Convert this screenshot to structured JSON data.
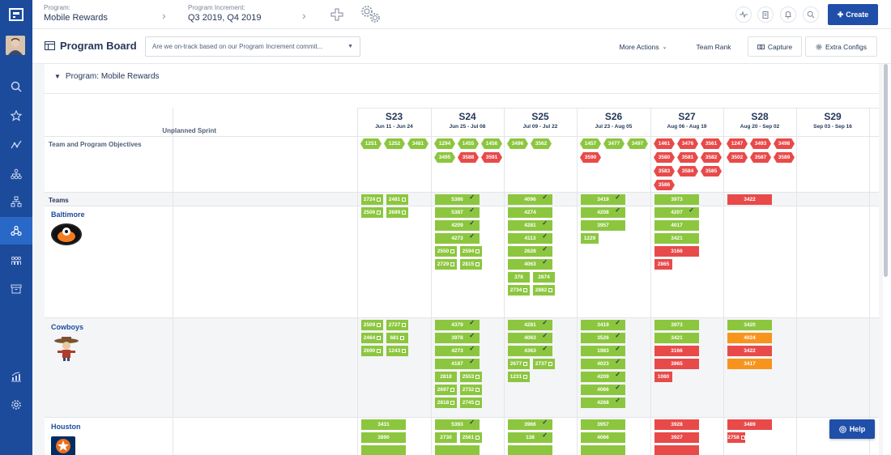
{
  "topbar": {
    "program_label": "Program:",
    "program_value": "Mobile Rewards",
    "pi_label": "Program Increment:",
    "pi_value": "Q3 2019, Q4 2019",
    "create_label": "Create"
  },
  "toolbar": {
    "title": "Program Board",
    "filter_text": "Are we on-track based on our Program Increment commit...",
    "more_actions": "More Actions",
    "team_rank": "Team Rank",
    "capture": "Capture",
    "extra_configs": "Extra Configs"
  },
  "board": {
    "program_title": "Program: Mobile Rewards",
    "unplanned_label": "Unplanned Sprint",
    "objectives_label": "Team and Program Objectives",
    "teams_label": "Teams"
  },
  "sprints": [
    {
      "name": "S23",
      "dates": "Jun 11 - Jun 24"
    },
    {
      "name": "S24",
      "dates": "Jun 25 - Jul 08"
    },
    {
      "name": "S25",
      "dates": "Jul 09 - Jul 22"
    },
    {
      "name": "S26",
      "dates": "Jul 23 - Aug 05"
    },
    {
      "name": "S27",
      "dates": "Aug 06 - Aug 19"
    },
    {
      "name": "S28",
      "dates": "Aug 20 - Sep 02"
    },
    {
      "name": "S29",
      "dates": "Sep 03 - Sep 16"
    }
  ],
  "objectives": [
    [
      {
        "id": "1251",
        "c": "g"
      },
      {
        "id": "1252",
        "c": "g"
      },
      {
        "id": "3481",
        "c": "g"
      }
    ],
    [
      {
        "id": "1294",
        "c": "g"
      },
      {
        "id": "1455",
        "c": "g"
      },
      {
        "id": "1456",
        "c": "g"
      },
      {
        "id": "3495",
        "c": "g"
      },
      {
        "id": "3588",
        "c": "r"
      },
      {
        "id": "3591",
        "c": "r"
      }
    ],
    [
      {
        "id": "3496",
        "c": "g"
      },
      {
        "id": "3562",
        "c": "g"
      }
    ],
    [
      {
        "id": "1457",
        "c": "g"
      },
      {
        "id": "3477",
        "c": "g"
      },
      {
        "id": "3497",
        "c": "g"
      },
      {
        "id": "3590",
        "c": "r"
      }
    ],
    [
      {
        "id": "1461",
        "c": "r"
      },
      {
        "id": "3476",
        "c": "r"
      },
      {
        "id": "3561",
        "c": "r"
      },
      {
        "id": "3580",
        "c": "r"
      },
      {
        "id": "3581",
        "c": "r"
      },
      {
        "id": "3582",
        "c": "r"
      },
      {
        "id": "3583",
        "c": "r"
      },
      {
        "id": "3584",
        "c": "r"
      },
      {
        "id": "3585",
        "c": "r"
      },
      {
        "id": "3586",
        "c": "r"
      }
    ],
    [
      {
        "id": "1247",
        "c": "r"
      },
      {
        "id": "3493",
        "c": "r"
      },
      {
        "id": "3498",
        "c": "r"
      },
      {
        "id": "3502",
        "c": "r"
      },
      {
        "id": "3587",
        "c": "r"
      },
      {
        "id": "3589",
        "c": "r"
      }
    ],
    []
  ],
  "teams": [
    {
      "name": "Baltimore",
      "logo": "orioles",
      "sprints": [
        [
          {
            "id": "2724",
            "c": "g",
            "m": "sq",
            "s": "half"
          },
          {
            "id": "2481",
            "c": "g",
            "m": "sq",
            "s": "half"
          },
          {
            "id": "2506",
            "c": "g",
            "m": "sq",
            "s": "half"
          },
          {
            "id": "2689",
            "c": "g",
            "m": "sq",
            "s": "half"
          }
        ],
        [
          {
            "id": "5386",
            "c": "g",
            "m": "tick"
          },
          {
            "id": "5387",
            "c": "g",
            "m": "tick"
          },
          {
            "id": "4209",
            "c": "g",
            "m": "tick"
          },
          {
            "id": "4273",
            "c": "g",
            "m": "tick"
          },
          {
            "id": "2550",
            "c": "g",
            "m": "sq",
            "s": "half"
          },
          {
            "id": "2594",
            "c": "g",
            "m": "sq",
            "s": "half"
          },
          {
            "id": "2729",
            "c": "g",
            "m": "sq",
            "s": "half"
          },
          {
            "id": "2815",
            "c": "g",
            "m": "sq",
            "s": "half"
          }
        ],
        [
          {
            "id": "4096",
            "c": "g",
            "m": "tick"
          },
          {
            "id": "4274",
            "c": "g"
          },
          {
            "id": "4281",
            "c": "g",
            "m": "tick"
          },
          {
            "id": "4113",
            "c": "g",
            "m": "tick"
          },
          {
            "id": "2628",
            "c": "g",
            "m": "tick"
          },
          {
            "id": "4063",
            "c": "g",
            "m": "tick"
          },
          {
            "id": "378",
            "c": "g",
            "s": "half"
          },
          {
            "id": "2874",
            "c": "g",
            "s": "half"
          },
          {
            "id": "2734",
            "c": "g",
            "m": "sq",
            "s": "half"
          },
          {
            "id": "2882",
            "c": "g",
            "m": "sq",
            "s": "half"
          }
        ],
        [
          {
            "id": "3419",
            "c": "g",
            "m": "tick"
          },
          {
            "id": "4208",
            "c": "g",
            "m": "tick"
          },
          {
            "id": "3957",
            "c": "g"
          },
          {
            "id": "1229",
            "c": "g",
            "s": "small"
          }
        ],
        [
          {
            "id": "3973",
            "c": "g"
          },
          {
            "id": "4207",
            "c": "g",
            "m": "tick"
          },
          {
            "id": "4017",
            "c": "g"
          },
          {
            "id": "3421",
            "c": "g"
          },
          {
            "id": "3166",
            "c": "r"
          },
          {
            "id": "2865",
            "c": "r",
            "s": "small"
          }
        ],
        [
          {
            "id": "3422",
            "c": "r"
          }
        ],
        []
      ]
    },
    {
      "name": "Cowboys",
      "logo": "cowboy",
      "sprints": [
        [
          {
            "id": "2509",
            "c": "g",
            "m": "sq",
            "s": "half"
          },
          {
            "id": "2727",
            "c": "g",
            "m": "sq",
            "s": "half"
          },
          {
            "id": "2464",
            "c": "g",
            "m": "sq",
            "s": "half"
          },
          {
            "id": "681",
            "c": "g",
            "m": "sq",
            "s": "half"
          },
          {
            "id": "2690",
            "c": "g",
            "m": "sq",
            "s": "half"
          },
          {
            "id": "1243",
            "c": "g",
            "m": "sq",
            "s": "half"
          }
        ],
        [
          {
            "id": "4379",
            "c": "g",
            "m": "tick"
          },
          {
            "id": "3978",
            "c": "g",
            "m": "tick"
          },
          {
            "id": "4273",
            "c": "g",
            "m": "tick"
          },
          {
            "id": "4187",
            "c": "g",
            "m": "tick"
          },
          {
            "id": "2818",
            "c": "g",
            "s": "half"
          },
          {
            "id": "2553",
            "c": "g",
            "m": "sq",
            "s": "half"
          },
          {
            "id": "2697",
            "c": "g",
            "m": "sq",
            "s": "half"
          },
          {
            "id": "2732",
            "c": "g",
            "m": "sq",
            "s": "half"
          },
          {
            "id": "2818",
            "c": "g",
            "m": "sq",
            "s": "half"
          },
          {
            "id": "2745",
            "c": "g",
            "m": "sq",
            "s": "half"
          }
        ],
        [
          {
            "id": "4281",
            "c": "g",
            "m": "tick"
          },
          {
            "id": "4063",
            "c": "g",
            "m": "tick"
          },
          {
            "id": "4363",
            "c": "g",
            "m": "tick"
          },
          {
            "id": "2677",
            "c": "g",
            "m": "sq",
            "s": "half"
          },
          {
            "id": "2737",
            "c": "g",
            "m": "sq",
            "s": "half"
          },
          {
            "id": "1231",
            "c": "g",
            "m": "sq",
            "s": "half"
          }
        ],
        [
          {
            "id": "3419",
            "c": "g",
            "m": "tick"
          },
          {
            "id": "3526",
            "c": "g",
            "m": "tick"
          },
          {
            "id": "1983",
            "c": "g",
            "m": "tick"
          },
          {
            "id": "4023",
            "c": "g",
            "m": "tick"
          },
          {
            "id": "4209",
            "c": "g",
            "m": "tick"
          },
          {
            "id": "4066",
            "c": "g",
            "m": "tick"
          },
          {
            "id": "4268",
            "c": "g",
            "m": "tick"
          }
        ],
        [
          {
            "id": "3973",
            "c": "g"
          },
          {
            "id": "3421",
            "c": "g"
          },
          {
            "id": "3166",
            "c": "r"
          },
          {
            "id": "3965",
            "c": "r"
          },
          {
            "id": "1080",
            "c": "r",
            "s": "small"
          }
        ],
        [
          {
            "id": "3420",
            "c": "g"
          },
          {
            "id": "4024",
            "c": "o"
          },
          {
            "id": "3422",
            "c": "r"
          },
          {
            "id": "3417",
            "c": "o"
          }
        ],
        []
      ]
    },
    {
      "name": "Houston",
      "logo": "astros",
      "sprints": [
        [
          {
            "id": "3431",
            "c": "g"
          },
          {
            "id": "3890",
            "c": "g"
          },
          {
            "id": "",
            "c": "g"
          }
        ],
        [
          {
            "id": "5393",
            "c": "g",
            "m": "tick"
          },
          {
            "id": "2730",
            "c": "g",
            "s": "half"
          },
          {
            "id": "2561",
            "c": "g",
            "m": "sq",
            "s": "half"
          },
          {
            "id": "",
            "c": "g"
          }
        ],
        [
          {
            "id": "3966",
            "c": "g",
            "m": "tick"
          },
          {
            "id": "138",
            "c": "g",
            "m": "tick"
          },
          {
            "id": "",
            "c": "g"
          }
        ],
        [
          {
            "id": "3957",
            "c": "g"
          },
          {
            "id": "4066",
            "c": "g"
          },
          {
            "id": "",
            "c": "g"
          }
        ],
        [
          {
            "id": "3928",
            "c": "r"
          },
          {
            "id": "3927",
            "c": "r"
          },
          {
            "id": "",
            "c": "r"
          }
        ],
        [
          {
            "id": "3489",
            "c": "r"
          },
          {
            "id": "2758",
            "c": "r",
            "m": "sq",
            "s": "small"
          }
        ],
        []
      ]
    }
  ],
  "help_label": "Help"
}
